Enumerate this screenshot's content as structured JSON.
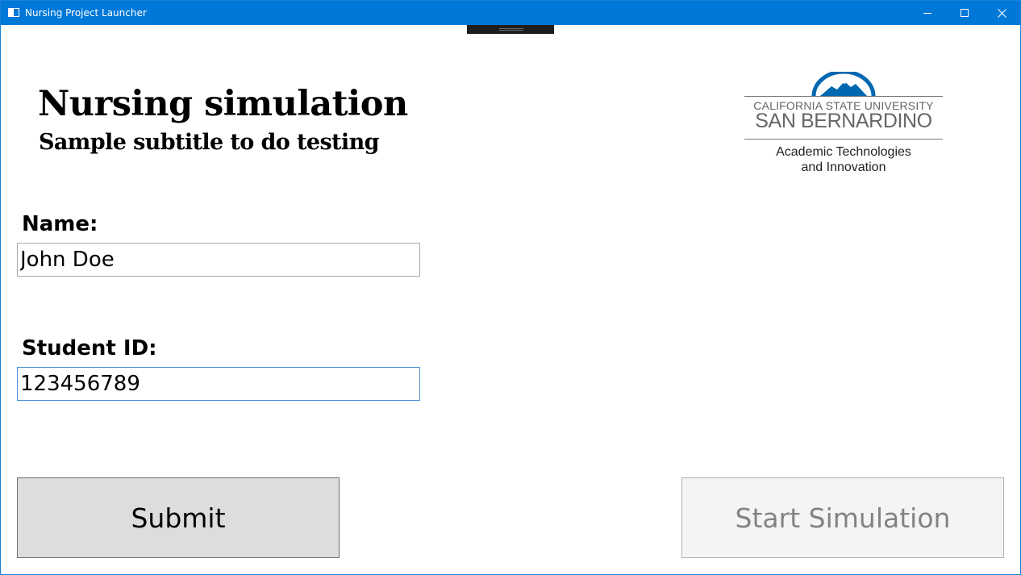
{
  "window": {
    "title": "Nursing Project Launcher",
    "accent_color": "#0078d7",
    "controls": [
      "minimize-icon",
      "maximize-icon",
      "close-icon"
    ]
  },
  "header": {
    "title": "Nursing simulation",
    "subtitle": "Sample subtitle to do testing"
  },
  "logo": {
    "university": "CALIFORNIA STATE UNIVERSITY",
    "campus": "SAN BERNARDINO",
    "department_line1": "Academic Technologies",
    "department_line2": "and Innovation",
    "brand_color": "#0067b1"
  },
  "form": {
    "name_label": "Name:",
    "name_value": "John Doe",
    "id_label": "Student ID:",
    "id_value": "123456789"
  },
  "actions": {
    "submit_label": "Submit",
    "start_label": "Start Simulation",
    "start_enabled": false
  }
}
